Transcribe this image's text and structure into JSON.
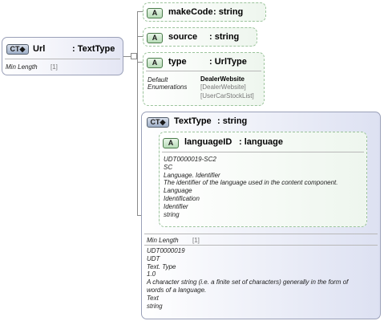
{
  "root": {
    "badge": "CT",
    "name": "Url",
    "type": ": TextType",
    "facet_label": "Min Length",
    "facet_value": "[1]"
  },
  "attributes": [
    {
      "badge": "A",
      "name": "makeCode",
      "type": ": string"
    },
    {
      "badge": "A",
      "name": "source",
      "type": ": string"
    },
    {
      "badge": "A",
      "name": "type",
      "type": ": UrlType",
      "default_label": "Default",
      "default_value": "DealerWebsite",
      "enum_label": "Enumerations",
      "enum_values": [
        "[DealerWebsite]",
        "[UserCarStockList]"
      ]
    }
  ],
  "text_type": {
    "badge": "CT",
    "name": "TextType",
    "type": ": string",
    "language_attr": {
      "badge": "A",
      "name": "languageID",
      "type": ": language",
      "doc": [
        "UDT0000019-SC2",
        "SC",
        "Language. Identifier",
        "The identifier of the language used in the content component.",
        "Language",
        "Identification",
        "Identifier",
        "string"
      ]
    },
    "facet_label": "Min Length",
    "facet_value": "[1]",
    "doc": [
      "UDT0000019",
      "UDT",
      "Text. Type",
      "1.0",
      "A character string (i.e. a finite set of characters) generally in the form of",
      "words of a language.",
      "Text",
      "string"
    ]
  },
  "colors": {
    "complex_border": "#9aa0b8",
    "attribute_border": "#9cc49c",
    "connector": "#8a8a8a"
  },
  "icons": [
    "complex-type-badge",
    "attribute-badge"
  ]
}
